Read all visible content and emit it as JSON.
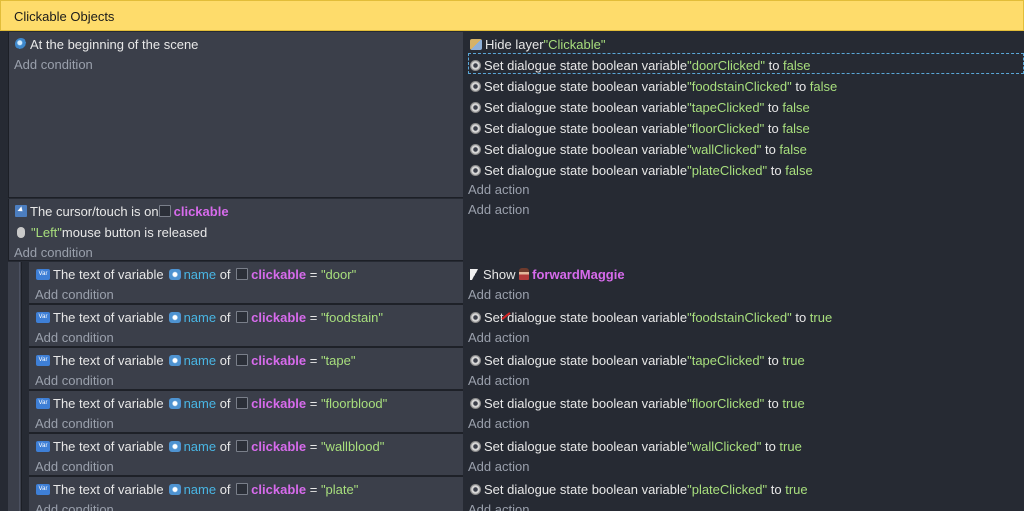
{
  "group_title": "Clickable Objects",
  "add_condition": "Add condition",
  "add_action": "Add action",
  "event1": {
    "condition": "At the beginning of the scene",
    "actions": [
      {
        "pre": "Hide layer ",
        "str": "\"Clickable\"",
        "mid": "",
        "val": ""
      },
      {
        "pre": "Set dialogue state boolean variable ",
        "str": "\"doorClicked\"",
        "mid": " to ",
        "val": "false"
      },
      {
        "pre": "Set dialogue state boolean variable ",
        "str": "\"foodstainClicked\"",
        "mid": " to ",
        "val": "false"
      },
      {
        "pre": "Set dialogue state boolean variable ",
        "str": "\"tapeClicked\"",
        "mid": " to ",
        "val": "false"
      },
      {
        "pre": "Set dialogue state boolean variable ",
        "str": "\"floorClicked\"",
        "mid": " to ",
        "val": "false"
      },
      {
        "pre": "Set dialogue state boolean variable ",
        "str": "\"wallClicked\"",
        "mid": " to ",
        "val": "false"
      },
      {
        "pre": "Set dialogue state boolean variable ",
        "str": "\"plateClicked\"",
        "mid": " to ",
        "val": "false"
      }
    ]
  },
  "event2": {
    "cond1_pre": "The cursor/touch is on ",
    "cond1_obj": "clickable",
    "cond2_str": "\"Left\"",
    "cond2_post": " mouse button is released"
  },
  "subevents": [
    {
      "value": "\"door\"",
      "action_kind": "show",
      "show_label": "Show ",
      "show_obj": "forwardMaggie"
    },
    {
      "value": "\"foodstain\"",
      "action_kind": "set",
      "var": "\"foodstainClicked\"",
      "val": "true"
    },
    {
      "value": "\"tape\"",
      "action_kind": "set",
      "var": "\"tapeClicked\"",
      "val": "true"
    },
    {
      "value": "\"floorblood\"",
      "action_kind": "set",
      "var": "\"floorClicked\"",
      "val": "true"
    },
    {
      "value": "\"wallblood\"",
      "action_kind": "set",
      "var": "\"wallClicked\"",
      "val": "true"
    },
    {
      "value": "\"plate\"",
      "action_kind": "set",
      "var": "\"plateClicked\"",
      "val": "true"
    }
  ],
  "sub_text": {
    "pre": "The text of variable ",
    "var": "name",
    "of": " of ",
    "obj": "clickable",
    "eq": " = "
  },
  "set_text": {
    "pre": "Set dialogue state boolean variable ",
    "to": " to "
  },
  "icons": [
    "scene-start-icon",
    "layer-icon",
    "gear-icon",
    "cursor-icon",
    "mouse-icon",
    "variable-icon",
    "globe-icon",
    "object-icon",
    "show-icon",
    "maggie-sprite-icon"
  ],
  "colors": {
    "header": "#fedc6b",
    "string": "#a8df7d",
    "object": "#d76bec",
    "variable": "#49b6e4",
    "panel": "#3b3f4a",
    "background": "#262a33"
  }
}
